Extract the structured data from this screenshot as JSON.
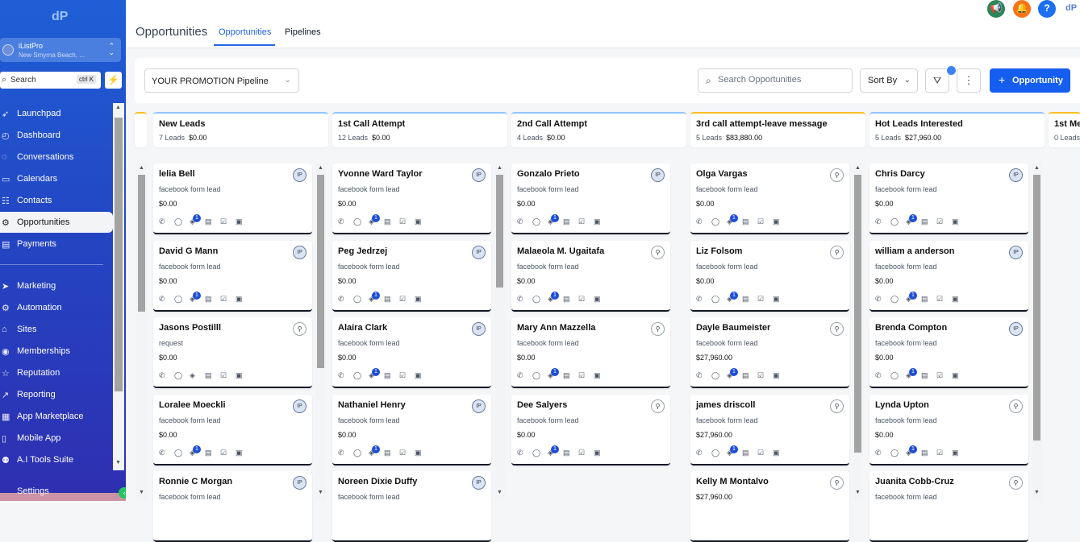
{
  "app": {
    "account_name": "iListPro",
    "account_location": "New Smyrna Beach, ...",
    "search_label": "Search",
    "search_shortcut": "ctrl K"
  },
  "sidebar": {
    "items": [
      {
        "label": "Launchpad",
        "icon": "rocket-icon"
      },
      {
        "label": "Dashboard",
        "icon": "dashboard-icon"
      },
      {
        "label": "Conversations",
        "icon": "chat-icon"
      },
      {
        "label": "Calendars",
        "icon": "calendar-icon"
      },
      {
        "label": "Contacts",
        "icon": "contacts-icon"
      },
      {
        "label": "Opportunities",
        "icon": "opportunities-icon",
        "active": true
      },
      {
        "label": "Payments",
        "icon": "payments-icon"
      },
      {
        "label": "Marketing",
        "icon": "send-icon"
      },
      {
        "label": "Automation",
        "icon": "automation-icon"
      },
      {
        "label": "Sites",
        "icon": "sites-icon"
      },
      {
        "label": "Memberships",
        "icon": "memberships-icon"
      },
      {
        "label": "Reputation",
        "icon": "star-icon"
      },
      {
        "label": "Reporting",
        "icon": "reporting-icon"
      },
      {
        "label": "App Marketplace",
        "icon": "marketplace-icon"
      },
      {
        "label": "Mobile App",
        "icon": "mobile-icon"
      },
      {
        "label": "A.I Tools Suite",
        "icon": "robot-icon"
      }
    ],
    "settings_label": "Settings"
  },
  "header": {
    "page_title": "Opportunities",
    "tabs": [
      {
        "label": "Opportunities",
        "active": true
      },
      {
        "label": "Pipelines",
        "active": false
      }
    ]
  },
  "toolbar": {
    "pipeline": "YOUR PROMOTION Pipeline",
    "search_placeholder": "Search Opportunities",
    "sort_label": "Sort By",
    "add_label": "Opportunity"
  },
  "columns": [
    {
      "title": "New Leads",
      "count": "7 Leads",
      "value": "$0.00"
    },
    {
      "title": "1st Call Attempt",
      "count": "12 Leads",
      "value": "$0.00"
    },
    {
      "title": "2nd Call Attempt",
      "count": "4 Leads",
      "value": "$0.00"
    },
    {
      "title": "3rd call attempt-leave message",
      "count": "5 Leads",
      "value": "$83,880.00"
    },
    {
      "title": "Hot Leads Interested",
      "count": "5 Leads",
      "value": "$27,960.00"
    },
    {
      "title": "1st Me",
      "count": "0 Leads",
      "value": ""
    }
  ],
  "cards": [
    [
      {
        "name": "lelia Bell",
        "source": "facebook form lead",
        "value": "$0.00",
        "badge": "IP",
        "tasks": "1"
      },
      {
        "name": "David G Mann",
        "source": "facebook form lead",
        "value": "$0.00",
        "badge": "IP",
        "tasks": "1"
      },
      {
        "name": "Jasons Postilll",
        "source": "request",
        "value": "$0.00",
        "badge": "user",
        "tasks": ""
      },
      {
        "name": "Loralee Moeckli",
        "source": "facebook form lead",
        "value": "$0.00",
        "badge": "IP",
        "tasks": "1"
      },
      {
        "name": "Ronnie C Morgan",
        "source": "facebook form lead",
        "value": "",
        "badge": "IP",
        "tasks": ""
      }
    ],
    [
      {
        "name": "Yvonne Ward Taylor",
        "source": "facebook form lead",
        "value": "$0.00",
        "badge": "IP",
        "tasks": "1"
      },
      {
        "name": "Peg Jedrzej",
        "source": "facebook form lead",
        "value": "$0.00",
        "badge": "IP",
        "tasks": "1"
      },
      {
        "name": "Alaira Clark",
        "source": "facebook form lead",
        "value": "$0.00",
        "badge": "IP",
        "tasks": "1"
      },
      {
        "name": "Nathaniel Henry",
        "source": "facebook form lead",
        "value": "$0.00",
        "badge": "IP",
        "tasks": "1"
      },
      {
        "name": "Noreen Dixie Duffy",
        "source": "facebook form lead",
        "value": "",
        "badge": "IP",
        "tasks": ""
      }
    ],
    [
      {
        "name": "Gonzalo Prieto",
        "source": "facebook form lead",
        "value": "$0.00",
        "badge": "IP",
        "tasks": "1"
      },
      {
        "name": "Malaeola M. Ugaitafa",
        "source": "facebook form lead",
        "value": "$0.00",
        "badge": "user",
        "tasks": "1"
      },
      {
        "name": "Mary Ann Mazzella",
        "source": "facebook form lead",
        "value": "$0.00",
        "badge": "user",
        "tasks": "1"
      },
      {
        "name": "Dee Salyers",
        "source": "facebook form lead",
        "value": "$0.00",
        "badge": "user",
        "tasks": "1"
      }
    ],
    [
      {
        "name": "Olga Vargas",
        "source": "facebook form lead",
        "value": "$0.00",
        "badge": "user",
        "tasks": "1"
      },
      {
        "name": "Liz Folsom",
        "source": "facebook form lead",
        "value": "$0.00",
        "badge": "user",
        "tasks": "1"
      },
      {
        "name": "Dayle Baumeister",
        "source": "facebook form lead",
        "value": "$27,960.00",
        "badge": "user",
        "tasks": "1"
      },
      {
        "name": "james driscoll",
        "source": "facebook form lead",
        "value": "$27,960.00",
        "badge": "user",
        "tasks": "1"
      },
      {
        "name": "Kelly M Montalvo",
        "source": "",
        "value": "$27,960.00",
        "badge": "user",
        "tasks": ""
      }
    ],
    [
      {
        "name": "Chris Darcy",
        "source": "facebook form lead",
        "value": "$0.00",
        "badge": "IP",
        "tasks": "1"
      },
      {
        "name": "william a anderson",
        "source": "facebook form lead",
        "value": "$0.00",
        "badge": "IP",
        "tasks": "1"
      },
      {
        "name": "Brenda Compton",
        "source": "facebook form lead",
        "value": "$0.00",
        "badge": "IP",
        "tasks": "1"
      },
      {
        "name": "Lynda Upton",
        "source": "facebook form lead",
        "value": "$0.00",
        "badge": "user",
        "tasks": "1"
      },
      {
        "name": "Juanita Cobb-Cruz",
        "source": "facebook form lead",
        "value": "",
        "badge": "user",
        "tasks": ""
      }
    ]
  ],
  "colors": {
    "accent": "#155eef",
    "sidebar_top": "#1f5fd6",
    "sidebar_bottom": "#2e2fb0"
  }
}
